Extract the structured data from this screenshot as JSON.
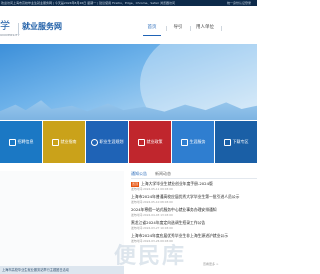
{
  "topbar": {
    "text": "欢迎访问上海市高校毕业生就业服务网 | 今天是2024年8月26日 星期一 | 建议使用 Firefox、Edge、Chrome、Safari 浏览器访问",
    "right_text": "统一身份认证登录"
  },
  "header": {
    "logo_char": "学",
    "logo_sub": "UNIVERSITY",
    "site_name": "就业服务网"
  },
  "nav": {
    "items": [
      {
        "label": "首页",
        "active": true
      },
      {
        "label": "导引",
        "active": false
      },
      {
        "label": "用人单位",
        "active": false
      },
      {
        "label": "",
        "active": false
      }
    ]
  },
  "tiles": [
    {
      "label": "招聘信息",
      "color": "#1b78c4"
    },
    {
      "label": "就业指南",
      "color": "#caa21a"
    },
    {
      "label": "职业生涯规划",
      "color": "#1f63b6"
    },
    {
      "label": "就业政策",
      "color": "#c0262d"
    },
    {
      "label": "生涯服务",
      "color": "#2f7ed0"
    },
    {
      "label": "下载专区",
      "color": "#1a5fa6"
    }
  ],
  "sidebar": {
    "caption": "上海市高校毕业生就业服务站举行主题团日活动"
  },
  "tabs": {
    "items": [
      {
        "label": "通知公告",
        "active": true
      },
      {
        "label": "新闻动态",
        "active": false
      }
    ]
  },
  "news": {
    "items": [
      {
        "title": "上海大学毕业生就业创业年度手册-2024版",
        "date": "发布时间:2024-05-11 09:03:00",
        "badge": "置顶"
      },
      {
        "title": "上海市2024年普通高校应届优秀大学毕业生第一批引进人员公示",
        "date": "发布时间:2024-05-10 08:03:00",
        "badge": ""
      },
      {
        "title": "2024年寒假一站式服务中心就业事务办理安排通知",
        "date": "发布时间:2024-04-03 13:03:00",
        "badge": ""
      },
      {
        "title": "黑龙江省2024年度定向选调生招录工作公告",
        "date": "发布时间:2024-03-27 10:03:00",
        "badge": ""
      },
      {
        "title": "上海市2024年度应届优秀毕业生非上海生源进沪就业公示",
        "date": "发布时间:2024-03-26 09:03:00",
        "badge": ""
      }
    ],
    "more": "查看更多 >"
  },
  "watermark": "便民库"
}
